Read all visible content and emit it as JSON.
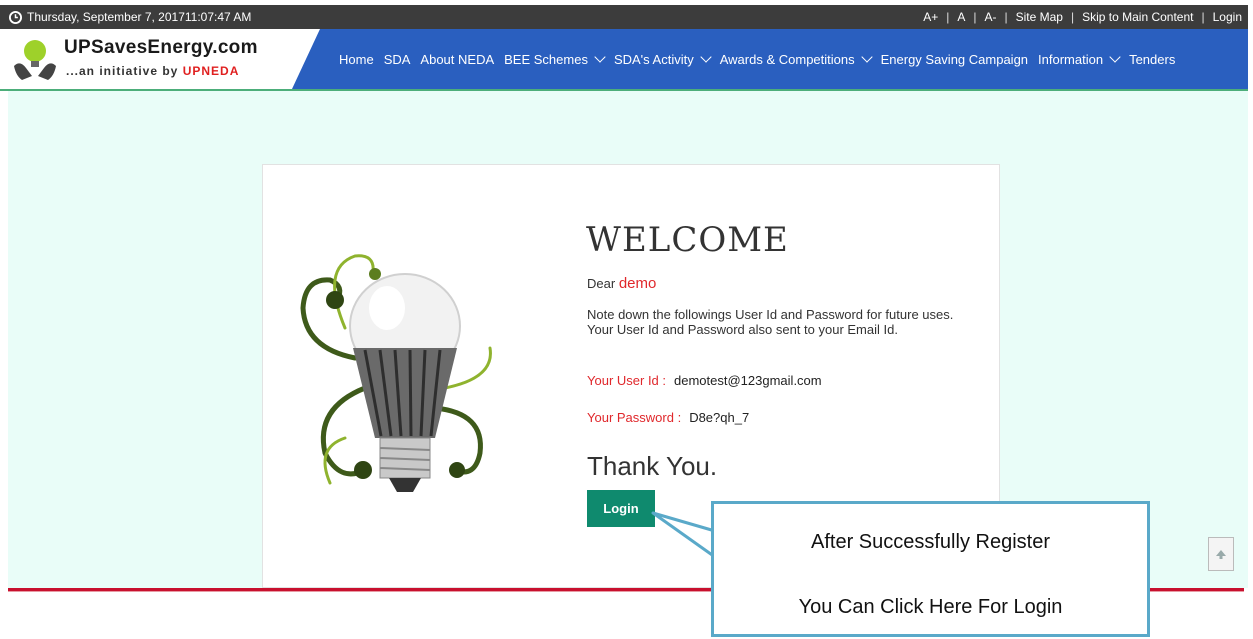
{
  "topbar": {
    "datetime": "Thursday, September 7, 201711:07:47 AM",
    "font_up": "A+",
    "font_normal": "A",
    "font_down": "A-",
    "sitemap": "Site Map",
    "skip": "Skip to Main Content",
    "login": "Login"
  },
  "logo": {
    "title": "UPSavesEnergy.com",
    "sub_prefix": "...an initiative by ",
    "sub_brand": "UPNEDA"
  },
  "nav": {
    "items": [
      {
        "label": "Home"
      },
      {
        "label": "SDA"
      },
      {
        "label": "About NEDA"
      },
      {
        "label": "BEE Schemes"
      },
      {
        "label": "SDA's Activity"
      },
      {
        "label": "Awards & Competitions"
      },
      {
        "label": "Energy Saving Campaign"
      },
      {
        "label": "Information"
      },
      {
        "label": "Tenders"
      }
    ]
  },
  "welcome": {
    "heading": "WELCOME",
    "dear": "Dear",
    "name": "demo",
    "note": "Note down the followings User Id and Password for future uses.",
    "note2": "Your User Id and Password also sent to your Email Id.",
    "userid_label": "Your User Id :",
    "userid_value": "demotest@123gmail.com",
    "password_label": "Your Password :",
    "password_value": "D8e?qh_7",
    "thanks": "Thank You.",
    "login_button": "Login"
  },
  "callout": {
    "line1": "After Successfully Register",
    "line2": "You Can Click Here For Login"
  },
  "colors": {
    "topbar": "#3c3c3c",
    "nav": "#2a5fbf",
    "background": "#e9fdf8",
    "accent_red": "#e0282c",
    "login_button": "#0f8a6e",
    "callout_border": "#5aa9c9"
  }
}
